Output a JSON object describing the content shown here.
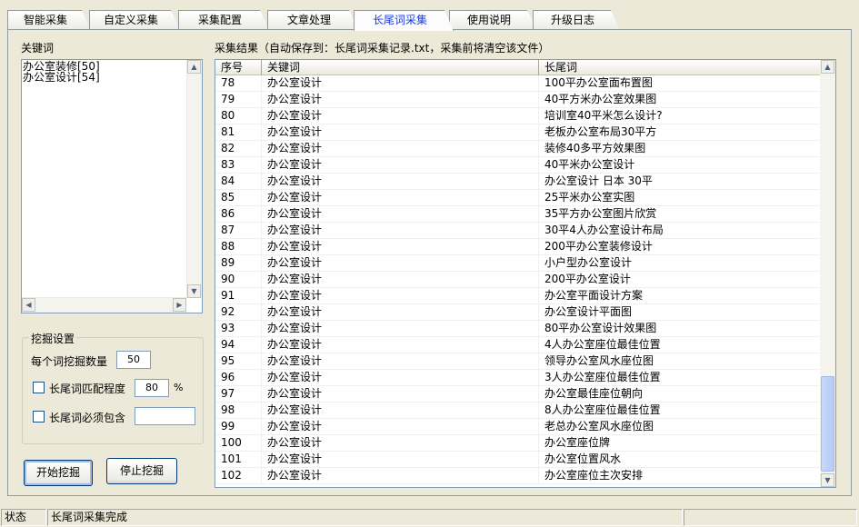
{
  "tabs": [
    "智能采集",
    "自定义采集",
    "采集配置",
    "文章处理",
    "长尾词采集",
    "使用说明",
    "升级日志"
  ],
  "keyword_panel": {
    "label": "关键词",
    "items": [
      "办公室装修[50]",
      "办公室设计[54]"
    ]
  },
  "settings": {
    "legend": "挖掘设置",
    "count_label": "每个词挖掘数量",
    "count_value": "50",
    "match_label": "长尾词匹配程度",
    "match_value": "80",
    "match_unit": "%",
    "include_label": "长尾词必须包含",
    "include_value": ""
  },
  "buttons": {
    "start": "开始挖掘",
    "stop": "停止挖掘"
  },
  "results": {
    "label": "采集结果（自动保存到：长尾词采集记录.txt，采集前将清空该文件）",
    "columns": [
      "序号",
      "关键词",
      "长尾词"
    ],
    "rows": [
      [
        "78",
        "办公室设计",
        "100平办公室面布置图"
      ],
      [
        "79",
        "办公室设计",
        "40平方米办公室效果图"
      ],
      [
        "80",
        "办公室设计",
        "培训室40平米怎么设计?"
      ],
      [
        "81",
        "办公室设计",
        "老板办公室布局30平方"
      ],
      [
        "82",
        "办公室设计",
        "装修40多平方效果图"
      ],
      [
        "83",
        "办公室设计",
        "40平米办公室设计"
      ],
      [
        "84",
        "办公室设计",
        "办公室设计 日本 30平"
      ],
      [
        "85",
        "办公室设计",
        "25平米办公室实图"
      ],
      [
        "86",
        "办公室设计",
        "35平方办公室图片欣赏"
      ],
      [
        "87",
        "办公室设计",
        "30平4人办公室设计布局"
      ],
      [
        "88",
        "办公室设计",
        "200平办公室装修设计"
      ],
      [
        "89",
        "办公室设计",
        "小户型办公室设计"
      ],
      [
        "90",
        "办公室设计",
        "200平办公室设计"
      ],
      [
        "91",
        "办公室设计",
        "办公室平面设计方案"
      ],
      [
        "92",
        "办公室设计",
        "办公室设计平面图"
      ],
      [
        "93",
        "办公室设计",
        "80平办公室设计效果图"
      ],
      [
        "94",
        "办公室设计",
        "4人办公室座位最佳位置"
      ],
      [
        "95",
        "办公室设计",
        "领导办公室风水座位图"
      ],
      [
        "96",
        "办公室设计",
        "3人办公室座位最佳位置"
      ],
      [
        "97",
        "办公室设计",
        "办公室最佳座位朝向"
      ],
      [
        "98",
        "办公室设计",
        "8人办公室座位最佳位置"
      ],
      [
        "99",
        "办公室设计",
        "老总办公室风水座位图"
      ],
      [
        "100",
        "办公室设计",
        "办公室座位牌"
      ],
      [
        "101",
        "办公室设计",
        "办公室位置风水"
      ],
      [
        "102",
        "办公室设计",
        "办公室座位主次安排"
      ]
    ]
  },
  "status": {
    "label": "状态",
    "message": "长尾词采集完成"
  }
}
